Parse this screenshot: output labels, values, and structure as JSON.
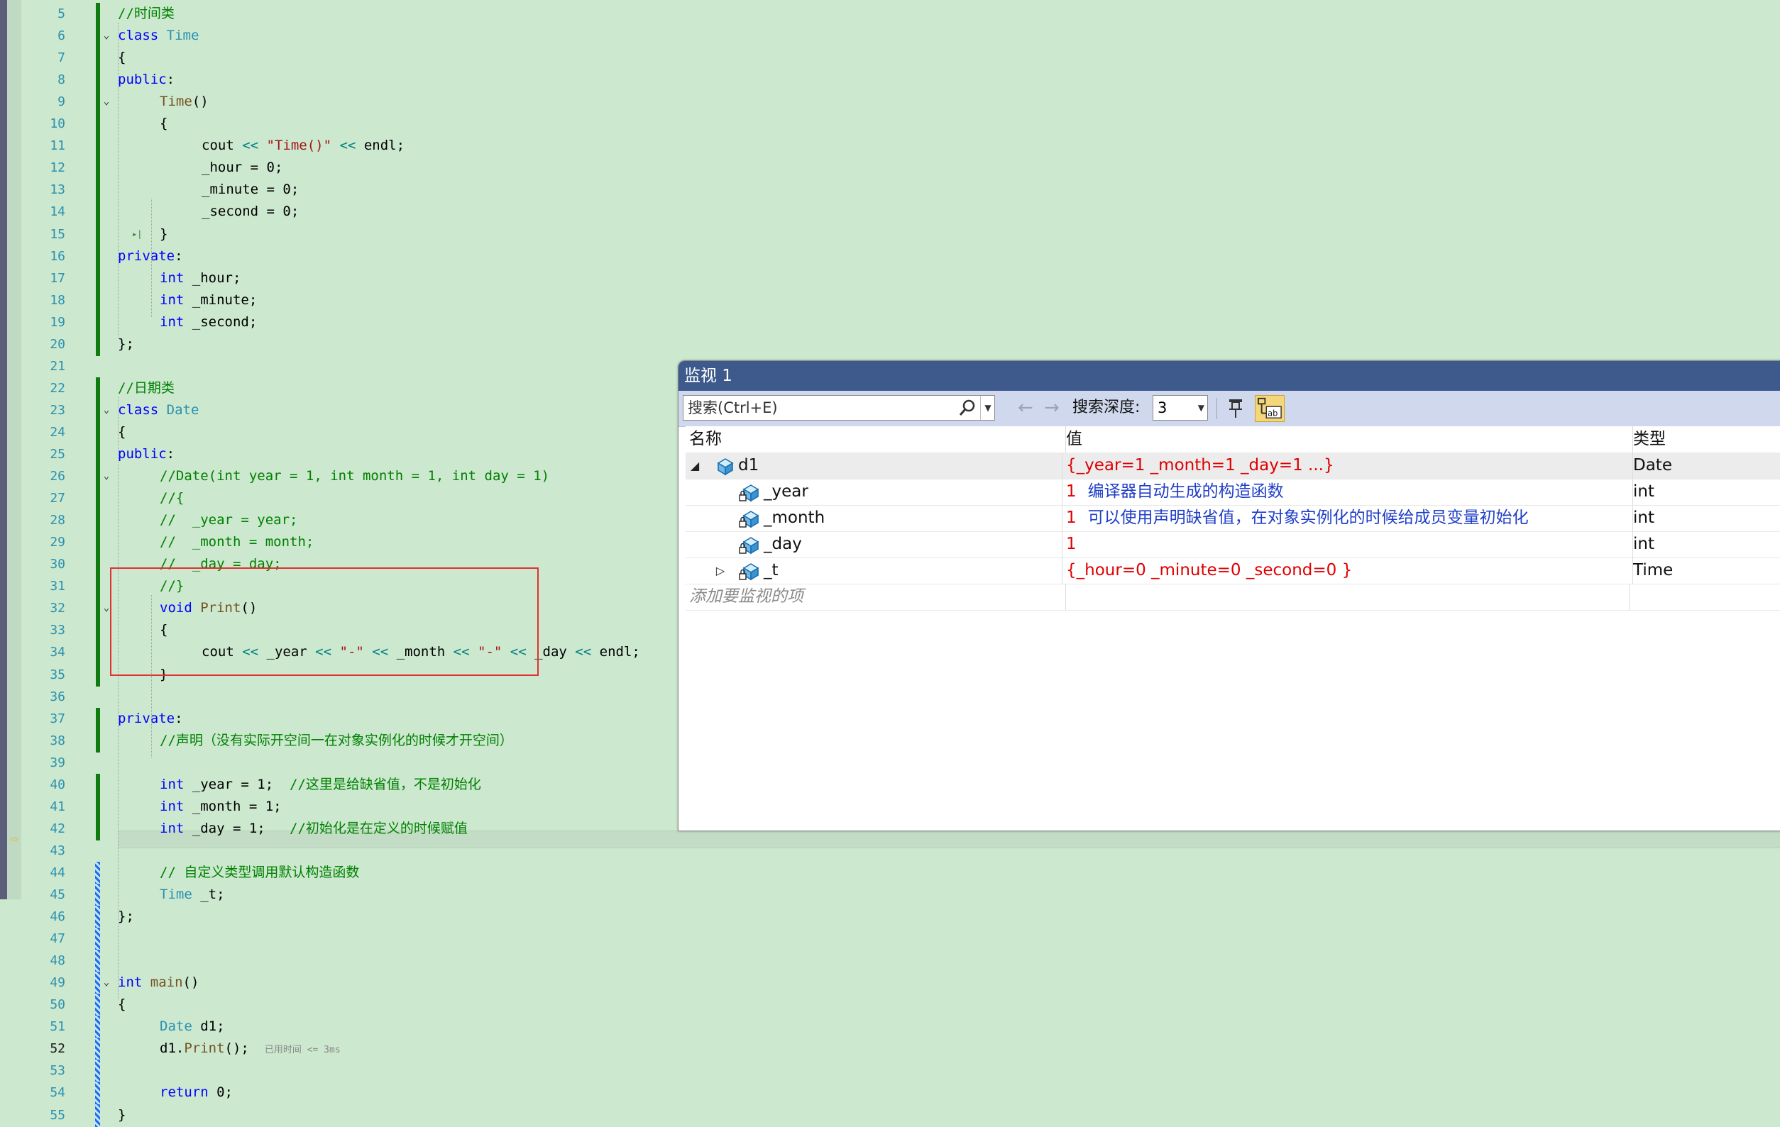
{
  "editor": {
    "lines": [
      {
        "n": "5",
        "fold": "",
        "bar": "saved",
        "ind": 0,
        "tokens": [
          [
            "cm",
            "//时间类"
          ]
        ]
      },
      {
        "n": "6",
        "fold": "⌄",
        "bar": "saved",
        "ind": 0,
        "tokens": [
          [
            "kw",
            "class "
          ],
          [
            "ty",
            "Time"
          ]
        ]
      },
      {
        "n": "7",
        "fold": "",
        "bar": "saved",
        "ind": 0,
        "tokens": [
          [
            "",
            "{"
          ]
        ]
      },
      {
        "n": "8",
        "fold": "",
        "bar": "saved",
        "ind": 0,
        "tokens": [
          [
            "kw",
            "public"
          ],
          [
            "",
            ":"
          ]
        ]
      },
      {
        "n": "9",
        "fold": "⌄",
        "bar": "saved",
        "ind": 1,
        "tokens": [
          [
            "fn",
            "Time"
          ],
          [
            "",
            "()"
          ]
        ]
      },
      {
        "n": "10",
        "fold": "",
        "bar": "saved",
        "ind": 1,
        "tokens": [
          [
            "",
            "{"
          ]
        ]
      },
      {
        "n": "11",
        "fold": "",
        "bar": "saved",
        "ind": 2,
        "tokens": [
          [
            "",
            "cout "
          ],
          [
            "op",
            "<<"
          ],
          [
            "st",
            " \"Time()\""
          ],
          [
            "op",
            " <<"
          ],
          [
            "",
            " endl;"
          ]
        ]
      },
      {
        "n": "12",
        "fold": "",
        "bar": "saved",
        "ind": 2,
        "tokens": [
          [
            "",
            "_hour = 0;"
          ]
        ]
      },
      {
        "n": "13",
        "fold": "",
        "bar": "saved",
        "ind": 2,
        "tokens": [
          [
            "",
            "_minute = 0;"
          ]
        ]
      },
      {
        "n": "14",
        "fold": "",
        "bar": "saved",
        "ind": 2,
        "tokens": [
          [
            "",
            "_second = 0;"
          ]
        ]
      },
      {
        "n": "15",
        "fold": "▸|",
        "bar": "saved",
        "ind": 1,
        "tokens": [
          [
            "",
            "}"
          ]
        ]
      },
      {
        "n": "16",
        "fold": "",
        "bar": "saved",
        "ind": 0,
        "tokens": [
          [
            "kw",
            "private"
          ],
          [
            "",
            ":"
          ]
        ]
      },
      {
        "n": "17",
        "fold": "",
        "bar": "saved",
        "ind": 1,
        "tokens": [
          [
            "kw",
            "int"
          ],
          [
            "",
            " _hour;"
          ]
        ]
      },
      {
        "n": "18",
        "fold": "",
        "bar": "saved",
        "ind": 1,
        "tokens": [
          [
            "kw",
            "int"
          ],
          [
            "",
            " _minute;"
          ]
        ]
      },
      {
        "n": "19",
        "fold": "",
        "bar": "saved",
        "ind": 1,
        "tokens": [
          [
            "kw",
            "int"
          ],
          [
            "",
            " _second;"
          ]
        ]
      },
      {
        "n": "20",
        "fold": "",
        "bar": "saved",
        "ind": 0,
        "tokens": [
          [
            "",
            "};"
          ]
        ]
      },
      {
        "n": "21",
        "fold": "",
        "bar": "",
        "ind": 0,
        "tokens": []
      },
      {
        "n": "22",
        "fold": "",
        "bar": "saved",
        "ind": 0,
        "tokens": [
          [
            "cm",
            "//日期类"
          ]
        ]
      },
      {
        "n": "23",
        "fold": "⌄",
        "bar": "saved",
        "ind": 0,
        "tokens": [
          [
            "kw",
            "class "
          ],
          [
            "ty",
            "Date"
          ]
        ]
      },
      {
        "n": "24",
        "fold": "",
        "bar": "saved",
        "ind": 0,
        "tokens": [
          [
            "",
            "{"
          ]
        ]
      },
      {
        "n": "25",
        "fold": "",
        "bar": "saved",
        "ind": 0,
        "tokens": [
          [
            "kw",
            "public"
          ],
          [
            "",
            ":"
          ]
        ]
      },
      {
        "n": "26",
        "fold": "⌄",
        "bar": "saved",
        "ind": 1,
        "tokens": [
          [
            "cm",
            "//Date(int year = 1, int month = 1, int day = 1)"
          ]
        ]
      },
      {
        "n": "27",
        "fold": "",
        "bar": "saved",
        "ind": 1,
        "tokens": [
          [
            "cm",
            "//{"
          ]
        ]
      },
      {
        "n": "28",
        "fold": "",
        "bar": "saved",
        "ind": 1,
        "tokens": [
          [
            "cm",
            "//  _year = year;"
          ]
        ]
      },
      {
        "n": "29",
        "fold": "",
        "bar": "saved",
        "ind": 1,
        "tokens": [
          [
            "cm",
            "//  _month = month;"
          ]
        ]
      },
      {
        "n": "30",
        "fold": "",
        "bar": "saved",
        "ind": 1,
        "tokens": [
          [
            "cm",
            "//  _day = day;"
          ]
        ]
      },
      {
        "n": "31",
        "fold": "",
        "bar": "saved",
        "ind": 1,
        "tokens": [
          [
            "cm",
            "//}"
          ]
        ]
      },
      {
        "n": "32",
        "fold": "⌄",
        "bar": "saved",
        "ind": 1,
        "tokens": [
          [
            "kw",
            "void "
          ],
          [
            "fn",
            "Print"
          ],
          [
            "",
            "()"
          ]
        ]
      },
      {
        "n": "33",
        "fold": "",
        "bar": "saved",
        "ind": 1,
        "tokens": [
          [
            "",
            "{"
          ]
        ]
      },
      {
        "n": "34",
        "fold": "",
        "bar": "saved",
        "ind": 2,
        "tokens": [
          [
            "",
            "cout "
          ],
          [
            "op",
            "<<"
          ],
          [
            "",
            " _year "
          ],
          [
            "op",
            "<<"
          ],
          [
            "st",
            " \"-\""
          ],
          [
            "op",
            " <<"
          ],
          [
            "",
            " _month "
          ],
          [
            "op",
            "<<"
          ],
          [
            "st",
            " \"-\""
          ],
          [
            "op",
            " <<"
          ],
          [
            "",
            " _day "
          ],
          [
            "op",
            "<<"
          ],
          [
            "",
            " endl;"
          ]
        ]
      },
      {
        "n": "35",
        "fold": "",
        "bar": "saved",
        "ind": 1,
        "tokens": [
          [
            "",
            "}"
          ]
        ]
      },
      {
        "n": "36",
        "fold": "",
        "bar": "",
        "ind": 0,
        "tokens": []
      },
      {
        "n": "37",
        "fold": "",
        "bar": "saved",
        "ind": 0,
        "tokens": [
          [
            "kw",
            "private"
          ],
          [
            "",
            ":"
          ]
        ]
      },
      {
        "n": "38",
        "fold": "",
        "bar": "saved",
        "ind": 1,
        "tokens": [
          [
            "cm",
            "//声明（没有实际开空间一在对象实例化的时候才开空间）"
          ]
        ]
      },
      {
        "n": "39",
        "fold": "",
        "bar": "",
        "ind": 0,
        "tokens": []
      },
      {
        "n": "40",
        "fold": "",
        "bar": "saved",
        "ind": 1,
        "tokens": [
          [
            "kw",
            "int"
          ],
          [
            "",
            " _year = 1;  "
          ],
          [
            "cm",
            "//这里是给缺省值，不是初始化"
          ]
        ]
      },
      {
        "n": "41",
        "fold": "",
        "bar": "saved",
        "ind": 1,
        "tokens": [
          [
            "kw",
            "int"
          ],
          [
            "",
            " _month = 1;"
          ]
        ]
      },
      {
        "n": "42",
        "fold": "",
        "bar": "saved",
        "ind": 1,
        "tokens": [
          [
            "kw",
            "int"
          ],
          [
            "",
            " _day = 1;   "
          ],
          [
            "cm",
            "//初始化是在定义的时候赋值"
          ]
        ]
      },
      {
        "n": "43",
        "fold": "",
        "bar": "",
        "ind": 0,
        "tokens": []
      },
      {
        "n": "44",
        "fold": "",
        "bar": "unsaved",
        "ind": 1,
        "tokens": [
          [
            "cm",
            "// 自定义类型调用默认构造函数"
          ]
        ]
      },
      {
        "n": "45",
        "fold": "",
        "bar": "unsaved",
        "ind": 1,
        "tokens": [
          [
            "ty",
            "Time"
          ],
          [
            "",
            " _t;"
          ]
        ]
      },
      {
        "n": "46",
        "fold": "",
        "bar": "unsaved",
        "ind": 0,
        "tokens": [
          [
            "",
            "};"
          ]
        ]
      },
      {
        "n": "47",
        "fold": "",
        "bar": "unsaved",
        "ind": 0,
        "tokens": []
      },
      {
        "n": "48",
        "fold": "",
        "bar": "unsaved",
        "ind": 0,
        "tokens": []
      },
      {
        "n": "49",
        "fold": "⌄",
        "bar": "unsaved",
        "ind": 0,
        "tokens": [
          [
            "kw",
            "int "
          ],
          [
            "fn",
            "main"
          ],
          [
            "",
            "()"
          ]
        ]
      },
      {
        "n": "50",
        "fold": "",
        "bar": "unsaved",
        "ind": 0,
        "tokens": [
          [
            "",
            "{"
          ]
        ]
      },
      {
        "n": "51",
        "fold": "",
        "bar": "unsaved",
        "ind": 1,
        "tokens": [
          [
            "ty",
            "Date"
          ],
          [
            "",
            " d1;"
          ]
        ]
      },
      {
        "n": "52",
        "fold": "",
        "bar": "unsaved",
        "ind": 1,
        "current": true,
        "tokens": [
          [
            "",
            "d1."
          ],
          [
            "fn",
            "Print"
          ],
          [
            "",
            "();"
          ]
        ],
        "timing": "已用时间 <= 3ms"
      },
      {
        "n": "53",
        "fold": "",
        "bar": "unsaved",
        "ind": 0,
        "tokens": []
      },
      {
        "n": "54",
        "fold": "",
        "bar": "unsaved",
        "ind": 1,
        "tokens": [
          [
            "kw",
            "return"
          ],
          [
            "",
            " 0;"
          ]
        ]
      },
      {
        "n": "55",
        "fold": "",
        "bar": "unsaved",
        "ind": 0,
        "tokens": [
          [
            "",
            "}"
          ]
        ]
      }
    ]
  },
  "watch": {
    "title": "监视 1",
    "search_placeholder": "搜索(Ctrl+E)",
    "depth_label": "搜索深度:",
    "depth_value": "3",
    "columns": {
      "name": "名称",
      "value": "值",
      "type": "类型"
    },
    "rows": [
      {
        "indent": 0,
        "expander": "◢",
        "name": "d1",
        "value": "{_year=1 _month=1 _day=1 ...}",
        "annotation": "",
        "type": "Date",
        "selected": true,
        "icon": "object-icon"
      },
      {
        "indent": 1,
        "expander": "",
        "name": "_year",
        "value": "1",
        "annotation": "编译器自动生成的构造函数",
        "type": "int",
        "icon": "private-field-icon"
      },
      {
        "indent": 1,
        "expander": "",
        "name": "_month",
        "value": "1",
        "annotation": "可以使用声明缺省值，在对象实例化的时候给成员变量初始化",
        "type": "int",
        "icon": "private-field-icon"
      },
      {
        "indent": 1,
        "expander": "",
        "name": "_day",
        "value": "1",
        "annotation": "",
        "type": "int",
        "icon": "private-field-icon"
      },
      {
        "indent": 1,
        "expander": "▷",
        "name": "_t",
        "value": "{_hour=0 _minute=0 _second=0 }",
        "annotation": "",
        "type": "Time",
        "icon": "private-field-icon"
      }
    ],
    "add_item_text": "添加要监视的项"
  },
  "colors": {
    "editor_bg": "#cce8cf",
    "accent": "#3e5a8c",
    "value_red": "#e00000",
    "annotation_blue": "#1f3ec8"
  }
}
